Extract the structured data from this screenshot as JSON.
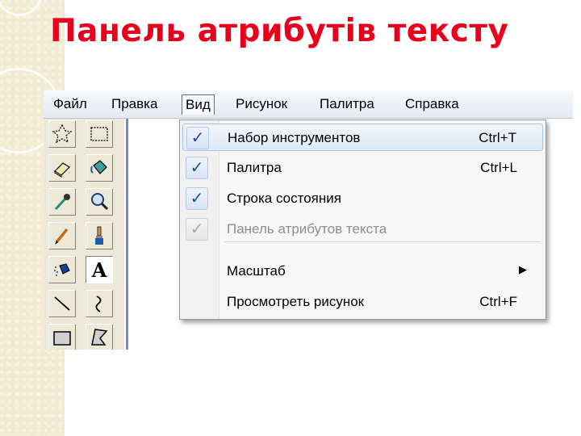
{
  "slide": {
    "title": "Панель атрибутів тексту"
  },
  "menubar": {
    "items": [
      {
        "label": "Файл"
      },
      {
        "label": "Правка"
      },
      {
        "label": "Вид"
      },
      {
        "label": "Рисунок"
      },
      {
        "label": "Палитра"
      },
      {
        "label": "Справка"
      }
    ],
    "active": "Вид"
  },
  "view_menu": {
    "items": [
      {
        "label": "Набор инструментов",
        "shortcut": "Ctrl+T",
        "checked": true,
        "enabled": true,
        "highlighted": true
      },
      {
        "label": "Палитра",
        "shortcut": "Ctrl+L",
        "checked": true,
        "enabled": true
      },
      {
        "label": "Строка состояния",
        "shortcut": "",
        "checked": true,
        "enabled": true
      },
      {
        "label": "Панель атрибутов текста",
        "shortcut": "",
        "checked": true,
        "enabled": false
      },
      {
        "label": "Масштаб",
        "submenu": true
      },
      {
        "label": "Просмотреть рисунок",
        "shortcut": "Ctrl+F"
      }
    ],
    "check_glyph": "✓",
    "submenu_glyph": "▶"
  },
  "toolbox": {
    "tools": [
      {
        "icon": "free-select-icon"
      },
      {
        "icon": "rect-select-icon"
      },
      {
        "icon": "eraser-icon"
      },
      {
        "icon": "fill-icon"
      },
      {
        "icon": "color-picker-icon"
      },
      {
        "icon": "magnifier-icon"
      },
      {
        "icon": "pencil-icon"
      },
      {
        "icon": "brush-icon"
      },
      {
        "icon": "airbrush-icon"
      },
      {
        "icon": "text-icon",
        "glyph": "A",
        "selected": true
      },
      {
        "icon": "line-icon"
      },
      {
        "icon": "curve-icon"
      },
      {
        "icon": "rectangle-icon"
      },
      {
        "icon": "polygon-icon"
      }
    ]
  },
  "colors": {
    "title": "#e8001c",
    "check": "#1f4d8f",
    "disabled_text": "#8d8d8d"
  }
}
